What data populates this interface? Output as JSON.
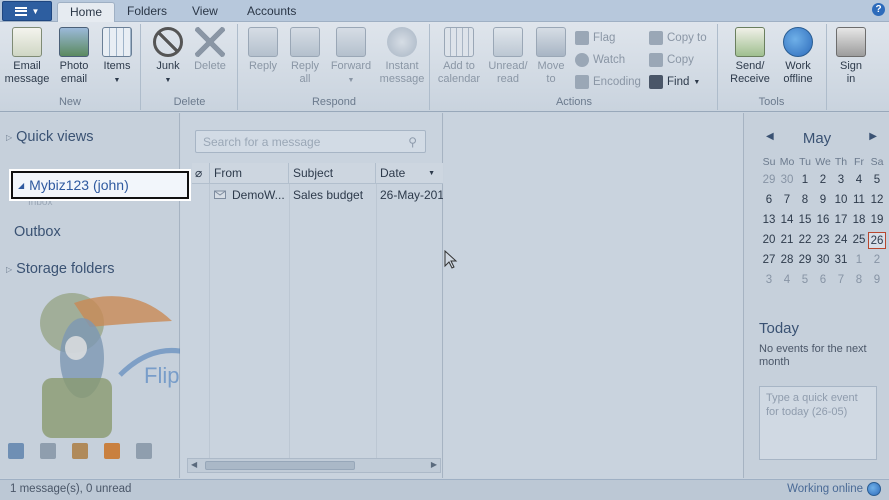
{
  "tabs": [
    "Home",
    "Folders",
    "View",
    "Accounts"
  ],
  "ribbon": {
    "new": {
      "label": "New",
      "buttons": [
        "Email message",
        "Photo email",
        "Items"
      ]
    },
    "delete": {
      "label": "Delete",
      "buttons": [
        "Junk",
        "Delete"
      ]
    },
    "respond": {
      "label": "Respond",
      "buttons": [
        "Reply",
        "Reply all",
        "Forward",
        "Instant message"
      ]
    },
    "actions": {
      "label": "Actions",
      "buttons": [
        "Add to calendar",
        "Unread/ read",
        "Move to"
      ],
      "small": [
        "Flag",
        "Watch",
        "Encoding",
        "Copy to",
        "Copy",
        "Find"
      ]
    },
    "tools": {
      "label": "Tools",
      "buttons": [
        "Send/ Receive",
        "Work offline",
        "Sign in"
      ]
    }
  },
  "nav": {
    "quick_views": "Quick views",
    "account": "Mybiz123 (john)",
    "inbox_ghost": "Inbox",
    "outbox": "Outbox",
    "storage": "Storage folders"
  },
  "search": {
    "placeholder": "Search for a message"
  },
  "list": {
    "columns": [
      "From",
      "Subject",
      "Date"
    ],
    "rows": [
      {
        "from": "DemoW...",
        "subject": "Sales budget",
        "date": "26-May-201"
      }
    ]
  },
  "calendar": {
    "month": "May",
    "dow": [
      "Su",
      "Mo",
      "Tu",
      "We",
      "Th",
      "Fr",
      "Sa"
    ],
    "weeks": [
      [
        "29",
        "30",
        "1",
        "2",
        "3",
        "4",
        "5"
      ],
      [
        "6",
        "7",
        "8",
        "9",
        "10",
        "11",
        "12"
      ],
      [
        "13",
        "14",
        "15",
        "16",
        "17",
        "18",
        "19"
      ],
      [
        "20",
        "21",
        "22",
        "23",
        "24",
        "25",
        "26"
      ],
      [
        "27",
        "28",
        "29",
        "30",
        "31",
        "1",
        "2"
      ],
      [
        "3",
        "4",
        "5",
        "6",
        "7",
        "8",
        "9"
      ]
    ],
    "today_title": "Today",
    "today_text": "No events for the next month",
    "quick_event": "Type a quick event for today (26-05)"
  },
  "mascot": {
    "brand": "FlipperHost"
  },
  "status": {
    "left": "1 message(s), 0 unread",
    "right": "Working online"
  },
  "colors": {
    "accent": "#2f5aa0",
    "ribbon": "#dfe5ec",
    "today_border": "#b8472e"
  }
}
